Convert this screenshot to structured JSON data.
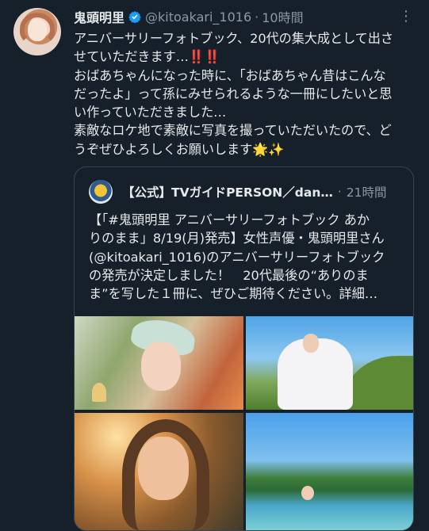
{
  "tweet": {
    "display_name": "鬼頭明里",
    "handle": "@kitoakari_1016",
    "separator": "·",
    "time": "10時間",
    "more_icon": "⋮",
    "body_lines": [
      "アニバーサリーフォトブック、20代の集大成として出さ",
      "せていただきます…‼️‼️",
      "おばあちゃんになった時に、「おばあちゃん昔はこんな",
      "だったよ」って孫にみせられるような一冊にしたいと思",
      "い作っていただきました…",
      "素敵なロケ地で素敵に写真を撮っていただいたので、ど",
      "うぞぜひよろしくお願いします🌟✨"
    ]
  },
  "quote": {
    "display_name": "【公式】TVガイドPERSON／dan…",
    "separator": "·",
    "time": "21時間",
    "body_lines": [
      "【「#鬼頭明里 アニバーサリーフォトブック あか",
      "りのまま」8/19(月)発売】女性声優・鬼頭明里さん",
      "(@kitoakari_1016)のアニバーサリーフォトブック",
      "の発売が決定しました！　20代最後の“ありのま",
      "ま”を写した１冊に、ぜひご期待ください。詳細…"
    ]
  },
  "colors": {
    "background": "#15202b",
    "text": "#e7e9ea",
    "secondary": "#8b98a5",
    "verified": "#1d9bf0",
    "border": "#38444d"
  }
}
